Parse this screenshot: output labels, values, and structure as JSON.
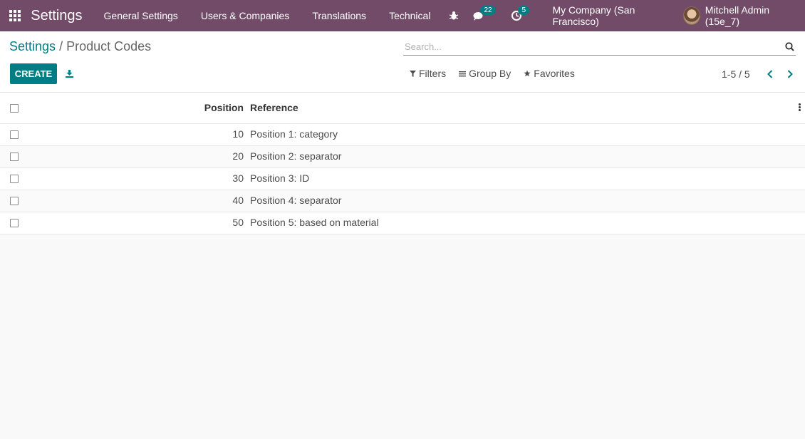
{
  "navbar": {
    "app_name": "Settings",
    "menu": [
      "General Settings",
      "Users & Companies",
      "Translations",
      "Technical"
    ],
    "messages_count": "22",
    "activities_count": "5",
    "company": "My Company (San Francisco)",
    "user": "Mitchell Admin (15e_7)",
    "colors": {
      "navbar": "#714b67",
      "badge": "#017e84"
    }
  },
  "breadcrumb": {
    "parent": "Settings",
    "separator": "/",
    "current": "Product Codes"
  },
  "search": {
    "placeholder": "Search..."
  },
  "toolbar": {
    "create_label": "CREATE"
  },
  "filters": {
    "filters_label": "Filters",
    "groupby_label": "Group By",
    "favorites_label": "Favorites"
  },
  "pager": {
    "value": "1-5 / 5"
  },
  "table": {
    "headers": {
      "position": "Position",
      "reference": "Reference"
    },
    "rows": [
      {
        "position": "10",
        "reference": "Position 1: category"
      },
      {
        "position": "20",
        "reference": "Position 2: separator"
      },
      {
        "position": "30",
        "reference": "Position 3: ID"
      },
      {
        "position": "40",
        "reference": "Position 4: separator"
      },
      {
        "position": "50",
        "reference": "Position 5: based on material"
      }
    ]
  },
  "theme": {
    "primary": "#017e84",
    "background": "#f9f9f9"
  }
}
